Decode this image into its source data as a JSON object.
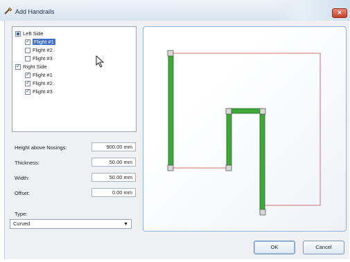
{
  "window": {
    "title": "Add Handrails"
  },
  "tree": {
    "groups": [
      {
        "label": "Left Side",
        "state": "partial",
        "items": [
          {
            "label": "Flight #1",
            "checked": true,
            "selected": true
          },
          {
            "label": "Flight #2",
            "checked": false
          },
          {
            "label": "Flight #3",
            "checked": false
          }
        ]
      },
      {
        "label": "Right Side",
        "state": "checked",
        "items": [
          {
            "label": "Flight #1",
            "checked": true
          },
          {
            "label": "Flight #2",
            "checked": true
          },
          {
            "label": "Flight #3",
            "checked": true
          }
        ]
      }
    ]
  },
  "fields": {
    "height_label": "Height above Nosings:",
    "height_value": "900.00 mm",
    "thickness_label": "Thickness:",
    "thickness_value": "50.00 mm",
    "width_label": "Width:",
    "width_value": "50.00 mm",
    "offset_label": "Offset:",
    "offset_value": "0.00 mm",
    "type_label": "Type:",
    "type_value": "Curved"
  },
  "buttons": {
    "ok": "OK",
    "cancel": "Cancel"
  },
  "colors": {
    "rail": "#3ea83b",
    "outline": "#d56f74",
    "selection": "#3b70c9"
  }
}
